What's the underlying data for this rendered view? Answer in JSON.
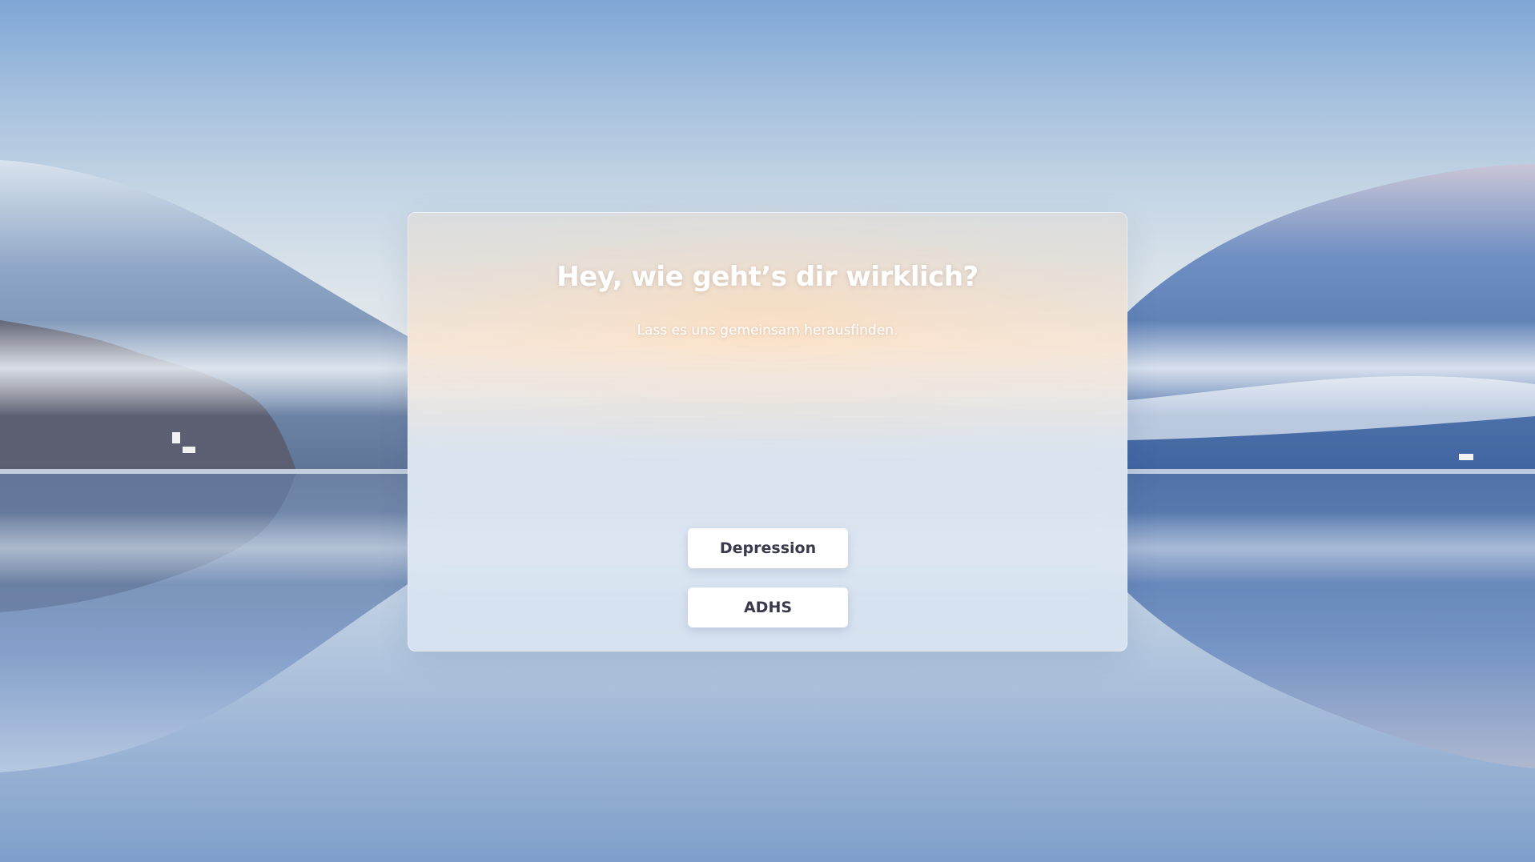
{
  "card": {
    "title": "Hey, wie geht’s dir wirklich?",
    "subtitle": "Lass es uns gemeinsam herausfinden."
  },
  "options": [
    {
      "label": "Depression"
    },
    {
      "label": "ADHS"
    }
  ],
  "colors": {
    "button_background": "#ffffff",
    "button_text": "#3a3a4e",
    "title_text": "#ffffff"
  }
}
